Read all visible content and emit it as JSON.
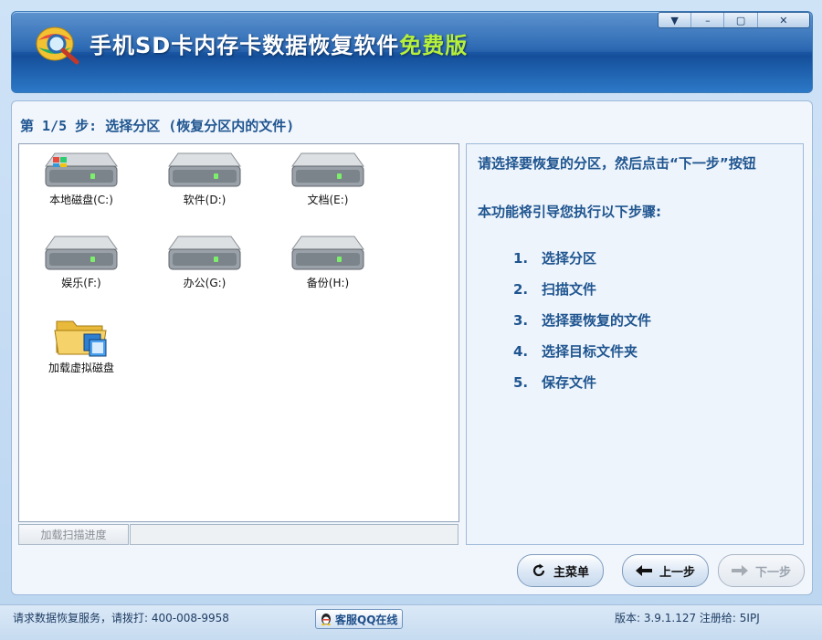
{
  "window": {
    "title_main": "手机SD卡内存卡数据恢复软件",
    "title_highlight": "免费版",
    "controls": [
      "▼",
      "–",
      "▢",
      "✕"
    ]
  },
  "step_header": "第 1/5 步: 选择分区 (恢复分区内的文件)",
  "drives": [
    {
      "label": "本地磁盘(C:)",
      "icon": "system-drive-icon"
    },
    {
      "label": "软件(D:)",
      "icon": "hard-drive-icon"
    },
    {
      "label": "文档(E:)",
      "icon": "hard-drive-icon"
    },
    {
      "label": "娱乐(F:)",
      "icon": "hard-drive-icon"
    },
    {
      "label": "办公(G:)",
      "icon": "hard-drive-icon"
    },
    {
      "label": "备份(H:)",
      "icon": "hard-drive-icon"
    },
    {
      "label": "加载虚拟磁盘",
      "icon": "virtual-disk-folder-icon"
    }
  ],
  "progress_button": "加载扫描进度",
  "info": {
    "prompt": "请选择要恢复的分区，然后点击“下一步”按钮",
    "intro": "本功能将引导您执行以下步骤:",
    "steps": [
      {
        "num": "1.",
        "text": "选择分区"
      },
      {
        "num": "2.",
        "text": "扫描文件"
      },
      {
        "num": "3.",
        "text": "选择要恢复的文件"
      },
      {
        "num": "4.",
        "text": "选择目标文件夹"
      },
      {
        "num": "5.",
        "text": "保存文件"
      }
    ]
  },
  "nav": {
    "main_menu": "主菜单",
    "prev": "上一步",
    "next": "下一步"
  },
  "status": {
    "service": "请求数据恢复服务，请拨打: 400-008-9958",
    "qq": "客服QQ在线",
    "version": "版本: 3.9.1.127 注册给:  5IPJ"
  },
  "colors": {
    "accent": "#1f5590",
    "header": "#1e5fae",
    "free_text": "#b6f03a"
  }
}
